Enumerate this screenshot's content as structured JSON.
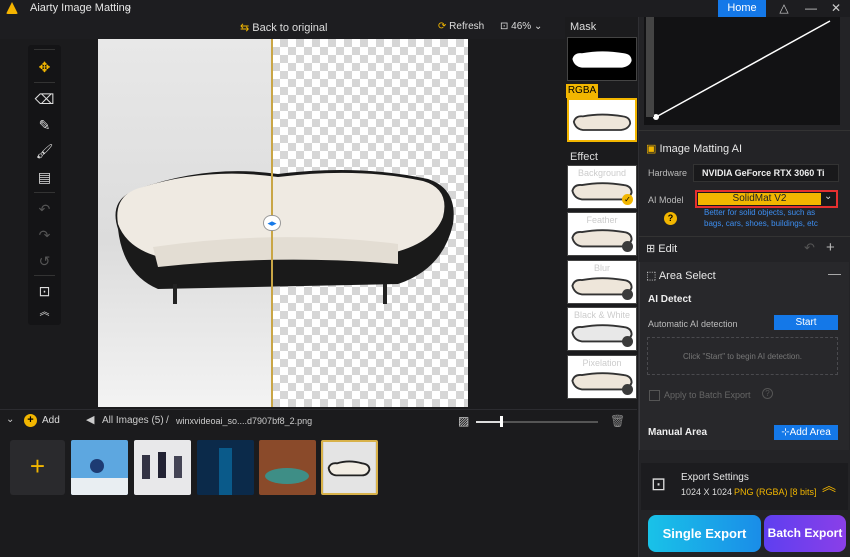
{
  "app": {
    "title": "Aiarty Image Matting",
    "home_label": "Home"
  },
  "toolbar": {
    "back_label": "Back to original",
    "refresh_label": "Refresh",
    "zoom": "46%"
  },
  "thumbs": {
    "mask_label": "Mask",
    "rgba_label": "RGBA",
    "effect_label": "Effect",
    "effects": [
      "Background",
      "Feather",
      "Blur",
      "Black & White",
      "Pixelation"
    ]
  },
  "panel": {
    "matting_title": "Image Matting AI",
    "hardware_label": "Hardware",
    "hardware_value": "NVIDIA GeForce RTX 3060 Ti",
    "model_label": "AI Model",
    "model_value": "SolidMat  V2",
    "model_desc": "Better for solid objects, such as bags, cars, shoes, buildings, etc",
    "edit_title": "Edit",
    "area_title": "Area Select",
    "ai_detect_title": "AI Detect",
    "auto_detect_label": "Automatic AI detection",
    "start_label": "Start",
    "detect_hint": "Click \"Start\" to begin AI detection.",
    "batch_label": "Apply to Batch Export",
    "manual_title": "Manual Area",
    "add_area_label": "Add Area",
    "export_title": "Export Settings",
    "export_size": "1024 X 1024",
    "export_format": "PNG (RGBA) [8 bits]",
    "single_export": "Single Export",
    "batch_export": "Batch Export"
  },
  "bottom": {
    "add_label": "Add",
    "all_images": "All Images (5)",
    "sep": "/",
    "filename": "winxvideoai_so....d7907bf8_2.png"
  },
  "colors": {
    "accent": "#f2b600",
    "primary": "#1478e8"
  }
}
